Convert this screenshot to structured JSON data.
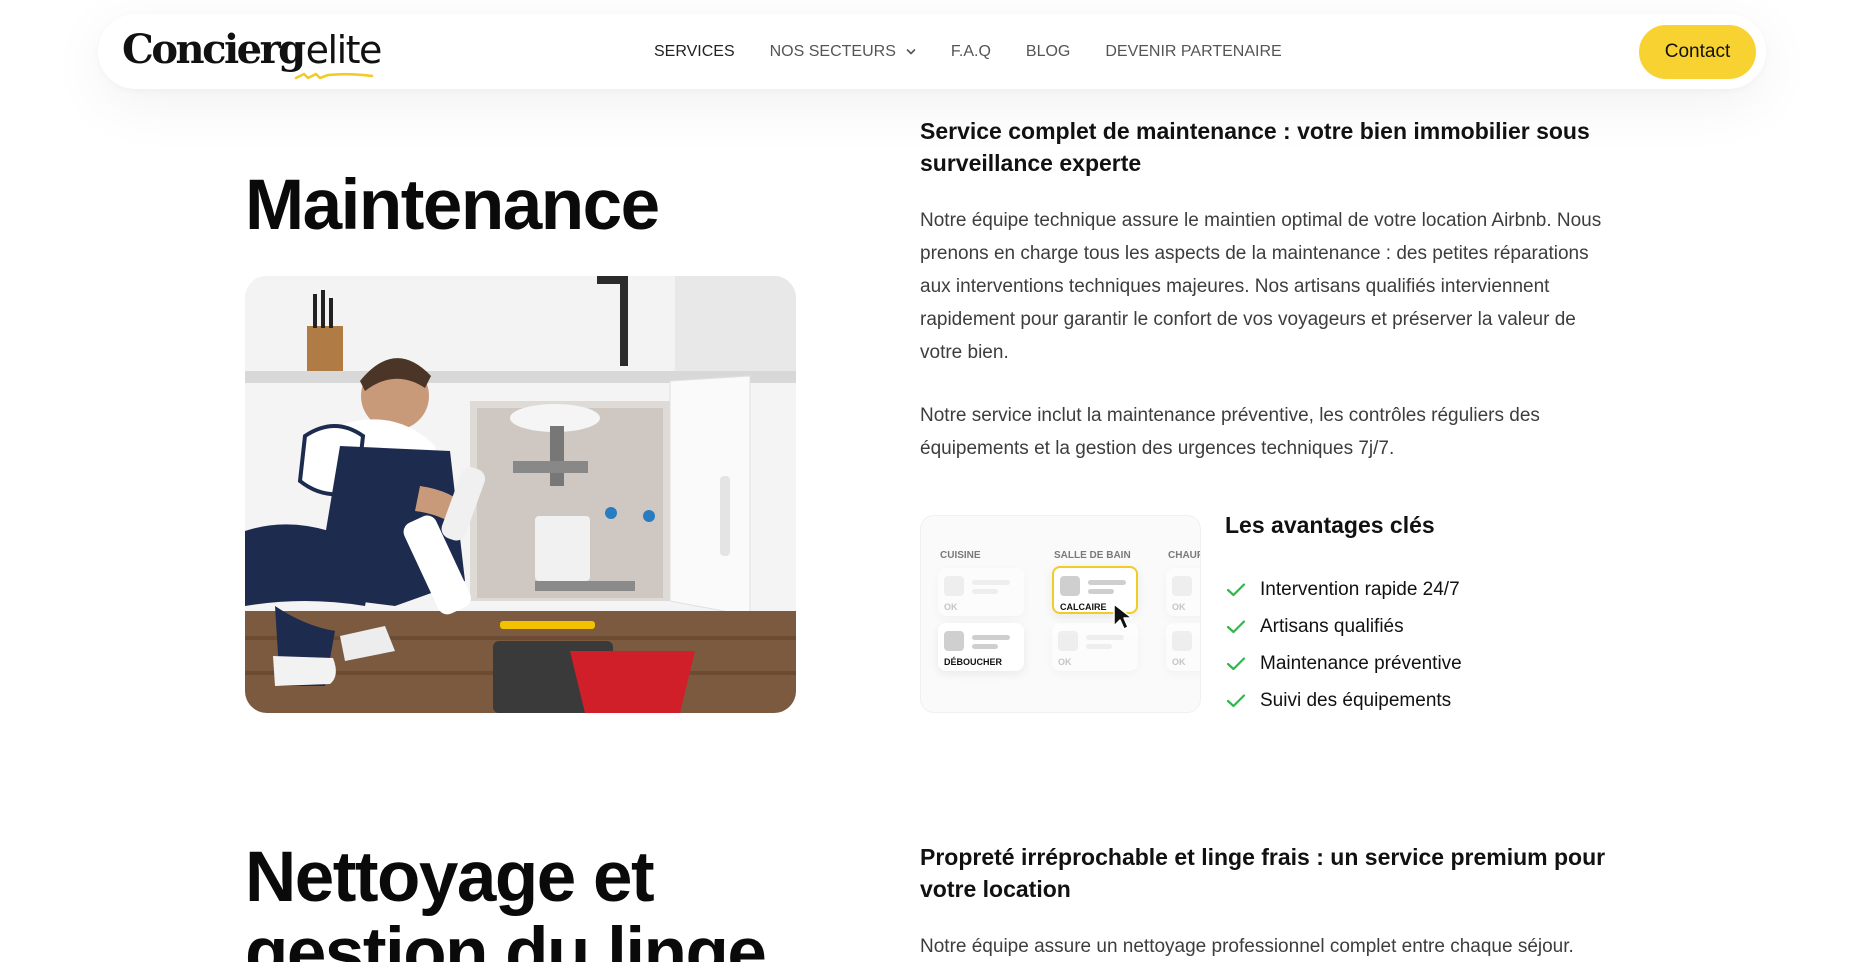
{
  "brand": {
    "logo_main": "Concierg",
    "logo_accent": "elite",
    "accent_color": "#f7d231"
  },
  "nav": {
    "items": [
      {
        "label": "SERVICES",
        "active": true
      },
      {
        "label": "NOS SECTEURS",
        "has_dropdown": true
      },
      {
        "label": "F.A.Q"
      },
      {
        "label": "BLOG"
      },
      {
        "label": "DEVENIR PARTENAIRE"
      }
    ],
    "contact_label": "Contact"
  },
  "maintenance": {
    "title": "Maintenance",
    "subhead": "Service complet de maintenance : votre bien immobilier sous surveillance experte",
    "para1": "Notre équipe technique assure le maintien optimal de votre location Airbnb. Nous prenons en charge tous les aspects de la maintenance : des petites réparations aux interventions techniques majeures. Nos artisans qualifiés interviennent rapidement pour garantir le confort de vos voyageurs et préserver la valeur de votre bien.",
    "para2": "Notre service inclut la maintenance préventive, les contrôles réguliers des équipements et la gestion des urgences techniques 7j/7.",
    "mockup": {
      "columns": [
        "CUISINE",
        "SALLE DE BAIN",
        "CHAUF"
      ],
      "tiles": {
        "kitchen_top": "OK",
        "kitchen_bottom": "DÉBOUCHER",
        "bath_top": "CALCAIRE",
        "bath_bottom": "OK",
        "heat_top": "OK",
        "heat_bottom": "OK"
      }
    },
    "advantages_title": "Les avantages clés",
    "advantages": [
      "Intervention rapide 24/7",
      "Artisans qualifiés",
      "Maintenance préventive",
      "Suivi des équipements"
    ],
    "check_color": "#2eb84c"
  },
  "nettoyage": {
    "title_line1": "Nettoyage et",
    "title_line2": "gestion du linge",
    "subhead": "Propreté irréprochable et linge frais : un service premium pour votre location",
    "para1": "Notre équipe assure un nettoyage professionnel complet entre chaque séjour."
  }
}
